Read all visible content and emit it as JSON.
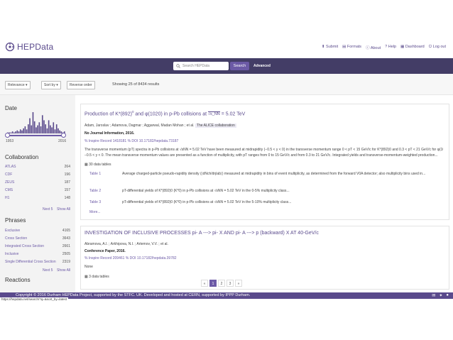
{
  "app": {
    "name": "HEPData"
  },
  "nav": {
    "links": [
      {
        "icon": "upload-icon",
        "label": "Submit"
      },
      {
        "icon": "file-icon",
        "label": "Formats"
      },
      {
        "icon": "info-icon",
        "label": "About"
      },
      {
        "icon": "help-icon",
        "label": "Help"
      },
      {
        "icon": "dashboard-icon",
        "label": "Dashboard"
      },
      {
        "icon": "logout-icon",
        "label": "Log out"
      }
    ]
  },
  "search": {
    "placeholder": "Search HEPData",
    "button": "Search",
    "advanced": "Advanced"
  },
  "sort": {
    "buttons": [
      "Relevance ▾",
      "Sort by ▾",
      "Reverse order"
    ],
    "showing": "Showing 25 of 8434 results"
  },
  "sidebar": {
    "date": {
      "title": "Date",
      "from": "1953",
      "to": "2016",
      "histogram": [
        1,
        1,
        1,
        2,
        1,
        2,
        3,
        2,
        4,
        3,
        5,
        7,
        4,
        9,
        15,
        8,
        21,
        12,
        6,
        8,
        11,
        7,
        18,
        13,
        9,
        5,
        13,
        8,
        6,
        11,
        4,
        9,
        5,
        3,
        2,
        1,
        2
      ]
    },
    "collaboration": {
      "title": "Collaboration",
      "items": [
        {
          "label": "ATLAS",
          "count": "264"
        },
        {
          "label": "CDF",
          "count": "196"
        },
        {
          "label": "ZEUS",
          "count": "187"
        },
        {
          "label": "CMS",
          "count": "157"
        },
        {
          "label": "H1",
          "count": "148"
        }
      ],
      "more": "Next 5",
      "all": "Show All"
    },
    "phrases": {
      "title": "Phrases",
      "items": [
        {
          "label": "Exclusive",
          "count": "4165"
        },
        {
          "label": "Cross Section",
          "count": "3643"
        },
        {
          "label": "Integrated Cross Section",
          "count": "2661"
        },
        {
          "label": "Inclusive",
          "count": "2505"
        },
        {
          "label": "Single Differential Cross Section",
          "count": "2319"
        }
      ],
      "more": "Next 5",
      "all": "Show All"
    },
    "reactions_title": "Reactions"
  },
  "results": [
    {
      "title_main": "Production of K*(892)",
      "title_sup1": "0",
      "title_mid": " and φ(1020) in p-Pb collisions at ",
      "title_sqrt": "√s_NN",
      "title_end": " = 5.02 TeV",
      "authors": "Adam, Jaroslav ; Adamova, Dagmar ; Aggarwal, Madan Mohan ; et al.",
      "collaboration": "The ALICE collaboration",
      "journal": "No Journal Information, 2016.",
      "inspire": "% Inspire Record 1418181 % DOI 10.17182/hepdata.73187",
      "abstract_1": "The transverse momentum (pT) spectra in p-Pb collisions at √sNN = 5.02 TeV have been measured at midrapidity (−0.5 < y < 0) in the transverse momentum range 0 < pT < 15 GeV/c for K*(892)0 and 0.3 < pT < 21 GeV/c for φ(1020) in multiplicity classes...",
      "abstract_2": "−0.5 < y < 0. The mean transverse momentum values are presented as a function of multiplicity, with pT ranges from 0 to 15 GeV/c and from 0.3 to 21 GeV/c. Integrated yields and transverse-momentum-weighted production...",
      "tables_label": "30 data tables",
      "tables": [
        {
          "name": "Table 1",
          "desc": "Average charged-particle pseudo-rapidity density (⟨dNch/dηlab⟩) measured at midrapidity in bins of event multiplicity, as determined from the forward V0A detector; also multiplicity bins used in..."
        },
        {
          "name": "Table 2",
          "desc": "pT-differential yields of K*(892)0 (K*0) in p-Pb collisions at √sNN = 5.02 TeV in the 0-5% multiplicity class..."
        },
        {
          "name": "Table 3",
          "desc": "pT-differential yields of K*(892)0 (K*0) in p-Pb collisions at √sNN = 5.02 TeV in the 5-10% multiplicity class..."
        }
      ],
      "more": "More..."
    },
    {
      "title": "INVESTIGATION OF INCLUSIVE PROCESSES pi- A ---> pi- X AND pi- A ---> p (backward) X AT 40-GeV/c",
      "authors": "Abramova, A.I. ; Arkhipova, N.I. ; Artemov, V.V. ; et al.",
      "journal": "Conference Paper, 2016.",
      "inspire": "% Inspire Record 209461 % DOI 10.17182/hepdata.39782",
      "abstract": "None",
      "tables_label": "3 data tables"
    }
  ],
  "pagination": {
    "prev": "«",
    "pages": [
      "1",
      "2",
      "3"
    ],
    "next": "»",
    "active": "1"
  },
  "footer": {
    "text": "Copyright © 2016 Durham HEPData Project, supported by the STFC. UK. Developed and hosted at CERN, supported by IPPP Durham.",
    "icons": [
      "mail-icon",
      "twitter-icon",
      "github-icon"
    ]
  },
  "status": {
    "url": "https://hepdata.net/search/?q=&sort_by=latest"
  },
  "colors": {
    "brand": "#5a4a8c",
    "accent": "#6c5aa6",
    "searchbar": "#433d66"
  }
}
